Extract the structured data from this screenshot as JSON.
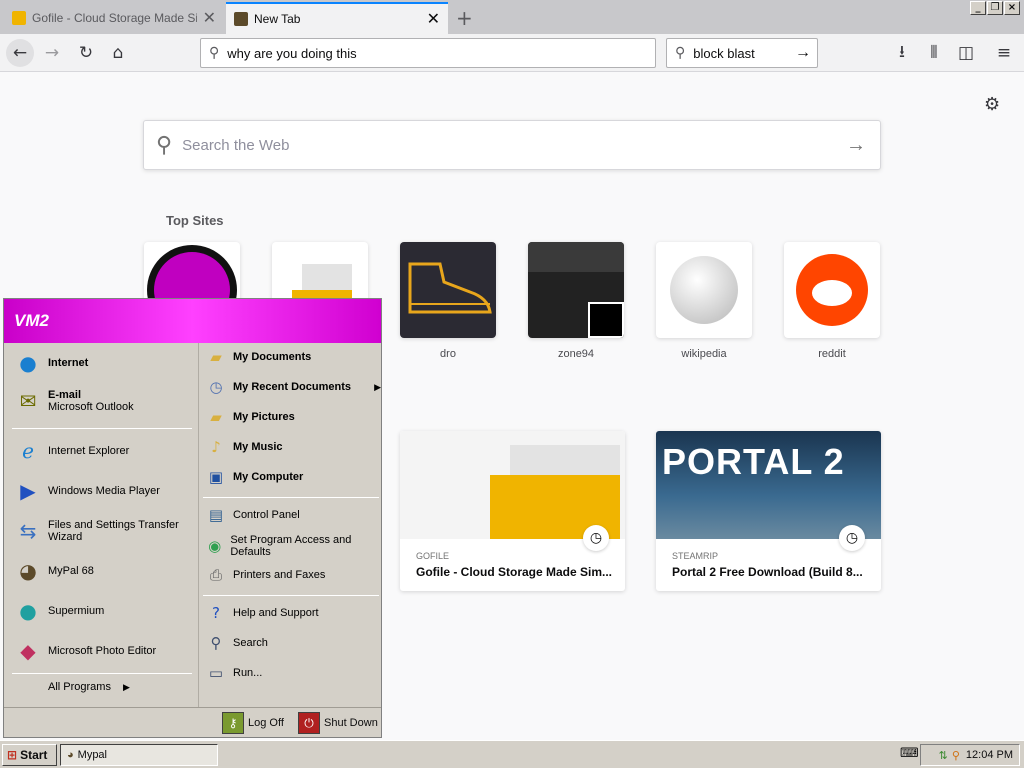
{
  "browser": {
    "tabs": [
      {
        "title": "Gofile - Cloud Storage Made Simp",
        "active": false
      },
      {
        "title": "New Tab",
        "active": true
      }
    ],
    "new_tab_icon": "plus-icon",
    "nav": {
      "back": "back-arrow-icon",
      "forward": "forward-arrow-icon",
      "reload": "reload-icon",
      "home": "home-icon"
    },
    "url_value": "why are you doing this",
    "search_value": "block blast",
    "toolbar_right": [
      "download-icon",
      "library-icon",
      "sidebar-icon",
      "menu-icon"
    ]
  },
  "newtab": {
    "search_placeholder": "Search the Web",
    "top_sites_heading": "Top Sites",
    "top_sites": [
      {
        "label": "",
        "icon": "steam-icon"
      },
      {
        "label": "",
        "icon": "gofile-icon"
      },
      {
        "label": "dro",
        "icon": "shoe-icon"
      },
      {
        "label": "zone94",
        "icon": "zone94-thumb"
      },
      {
        "label": "wikipedia",
        "icon": "wikipedia-globe-icon"
      },
      {
        "label": "reddit",
        "icon": "reddit-icon"
      }
    ],
    "highlights": [
      {
        "source": "GOFILE",
        "title": "Gofile - Cloud Storage Made Sim..."
      },
      {
        "source": "STEAMRIP",
        "title": "Portal 2 Free Download (Build 8...",
        "image_text": "PORTAL 2"
      }
    ]
  },
  "start_menu": {
    "user": "VM2",
    "left_pinned": [
      {
        "title": "Internet",
        "icon": "globe-icon"
      },
      {
        "title": "E-mail",
        "subtitle": "Microsoft Outlook",
        "icon": "email-icon"
      }
    ],
    "left_recent": [
      {
        "title": "Internet Explorer",
        "icon": "ie-icon"
      },
      {
        "title": "Windows Media Player",
        "icon": "media-player-icon"
      },
      {
        "title": "Files and Settings Transfer Wizard",
        "icon": "transfer-wizard-icon"
      },
      {
        "title": "MyPal 68",
        "icon": "mypal-icon"
      },
      {
        "title": "Supermium",
        "icon": "supermium-icon"
      },
      {
        "title": "Microsoft Photo Editor",
        "icon": "photo-editor-icon"
      }
    ],
    "all_programs": "All Programs",
    "right_places": [
      {
        "title": "My Documents",
        "icon": "documents-folder-icon"
      },
      {
        "title": "My Recent Documents",
        "icon": "recent-documents-icon",
        "submenu": true
      },
      {
        "title": "My Pictures",
        "icon": "pictures-folder-icon"
      },
      {
        "title": "My Music",
        "icon": "music-folder-icon"
      },
      {
        "title": "My Computer",
        "icon": "computer-icon"
      }
    ],
    "right_settings": [
      {
        "title": "Control Panel",
        "icon": "control-panel-icon"
      },
      {
        "title": "Set Program Access and Defaults",
        "icon": "program-access-icon"
      },
      {
        "title": "Printers and Faxes",
        "icon": "printer-icon"
      }
    ],
    "right_help": [
      {
        "title": "Help and Support",
        "icon": "help-icon"
      },
      {
        "title": "Search",
        "icon": "search-icon"
      },
      {
        "title": "Run...",
        "icon": "run-icon"
      }
    ],
    "log_off": "Log Off",
    "shut_down": "Shut Down"
  },
  "taskbar": {
    "start": "Start",
    "task_item": "Mypal",
    "clock": "12:04 PM"
  },
  "colors": {
    "accent": "#0a84ff",
    "start_menu_header": "#ff40ff"
  }
}
